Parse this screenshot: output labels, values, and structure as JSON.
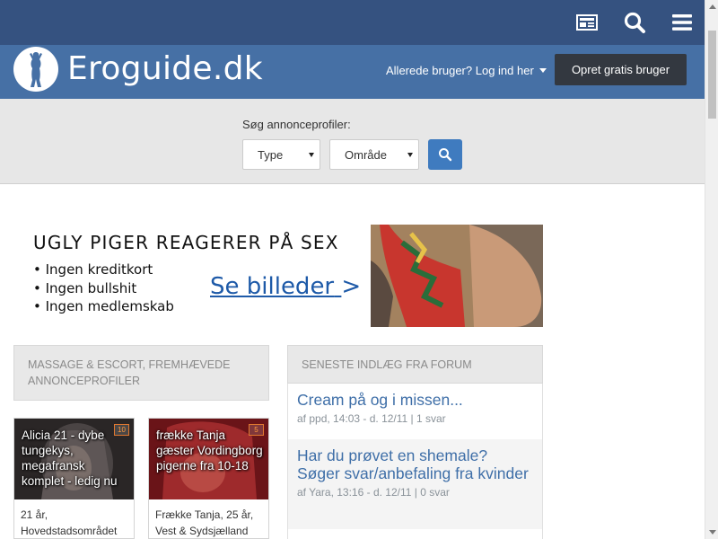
{
  "header": {
    "icons": [
      "newspaper-icon",
      "search-icon",
      "menu-icon"
    ],
    "brand": "Eroguide.dk",
    "login_text": "Allerede bruger? Log ind her",
    "signup_label": "Opret gratis bruger"
  },
  "search": {
    "label": "Søg annonceprofiler:",
    "type_value": "Type",
    "area_value": "Område"
  },
  "banner": {
    "title": "UGLY PIGER REAGERER PÅ SEX",
    "bullets": [
      "• Ingen kreditkort",
      "• Ingen bullshit",
      "• Ingen medlemskab"
    ],
    "cta": "Se billeder",
    "cta_arrow": ">"
  },
  "featured": {
    "heading": "MASSAGE & ESCORT, FREMHÆVEDE ANNONCEPROFILER",
    "cards": [
      {
        "title": "Alicia 21 - dybe tungekys, megafransk komplet - ledig nu",
        "count": "10",
        "meta1": "21 år,",
        "meta2": "Hovedstadsområdet"
      },
      {
        "title": "frække Tanja gæster Vordingborg pigerne fra 10-18",
        "count": "5",
        "meta1": "Frække Tanja, 25 år,",
        "meta2": "Vest & Sydsjælland"
      }
    ]
  },
  "forum": {
    "heading": "SENESTE INDLÆG FRA FORUM",
    "posts": [
      {
        "title": "Cream på og i missen...",
        "meta": "af ppd, 14:03 - d. 12/11 | 1 svar"
      },
      {
        "title": "Har du prøvet en shemale? Søger svar/anbefaling fra kvinder",
        "meta": "af Yara, 13:16 - d. 12/11 | 0 svar"
      }
    ]
  },
  "colors": {
    "topbar": "#355280",
    "brandbar": "#4670a5",
    "link": "#3f6fa8",
    "accent": "#3f7bbf"
  }
}
